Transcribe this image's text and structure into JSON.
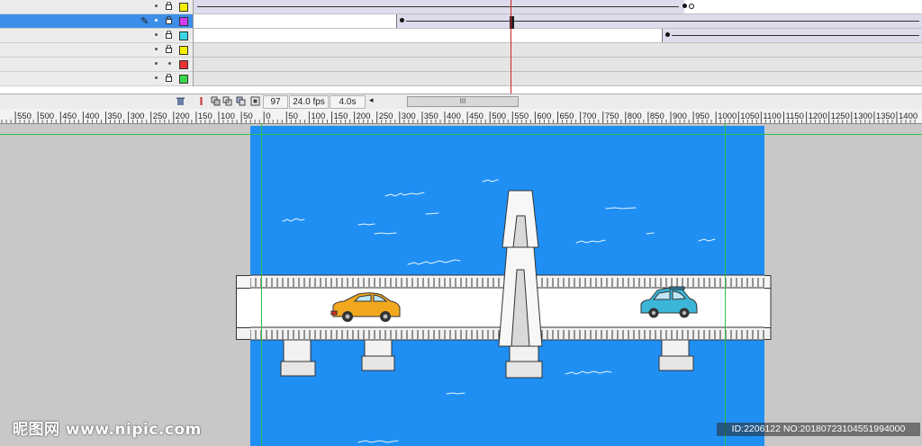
{
  "timeline": {
    "layers": [
      {
        "swatch": "#f6f000",
        "selected": false
      },
      {
        "swatch": "#d23cf2",
        "selected": true
      },
      {
        "swatch": "#38d8e8",
        "selected": false
      },
      {
        "swatch": "#f6f000",
        "selected": false
      },
      {
        "swatch": "#e83030",
        "selected": false
      },
      {
        "swatch": "#3ad84a",
        "selected": false
      }
    ]
  },
  "status": {
    "current_frame": "97",
    "frame_rate": "24.0 fps",
    "elapsed_time": "4.0s",
    "scroll_grip": "III"
  },
  "ruler": {
    "labels": [
      "0",
      "550",
      "500",
      "450",
      "400",
      "350",
      "300",
      "250",
      "200",
      "150",
      "100",
      "50",
      "0",
      "50",
      "100",
      "150",
      "200",
      "250",
      "300",
      "350",
      "400",
      "450",
      "500",
      "550",
      "600",
      "650",
      "700",
      "750",
      "800",
      "850",
      "900",
      "950",
      "1000",
      "1050",
      "1100",
      "1150",
      "1200",
      "1250",
      "1300",
      "1350",
      "1400"
    ]
  },
  "watermark": {
    "left": "昵图网 www.nipic.com",
    "right": "ID:2206122 NO:20180723104551994000"
  },
  "colors": {
    "stage": "#1f8ff3",
    "guide": "#2ec04a",
    "playhead": "#d02020",
    "selection": "#3d8ee9"
  }
}
